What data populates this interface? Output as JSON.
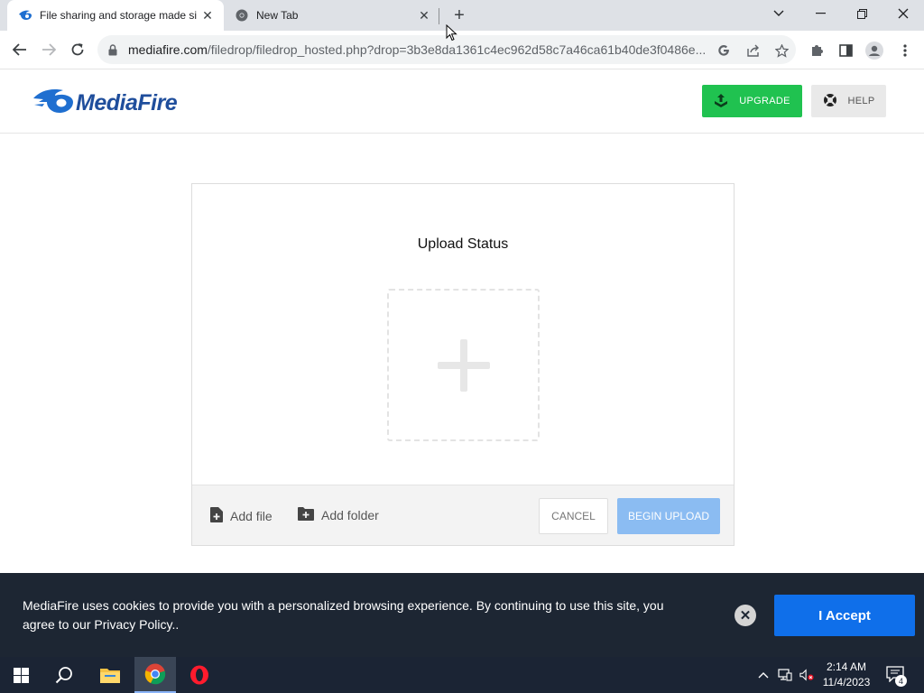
{
  "browser": {
    "tabs": [
      {
        "title": "File sharing and storage made si",
        "active": true
      },
      {
        "title": "New Tab",
        "active": false
      }
    ],
    "url_host": "mediafire.com",
    "url_path": "/filedrop/filedrop_hosted.php?drop=3b3e8da1361c4ec962d58c7a46ca61b40de3f0486e..."
  },
  "header": {
    "logo_text": "MediaFire",
    "upgrade_label": "UPGRADE",
    "help_label": "HELP"
  },
  "upload": {
    "title": "Upload Status",
    "add_file_label": "Add file",
    "add_folder_label": "Add folder",
    "cancel_label": "CANCEL",
    "begin_label": "BEGIN UPLOAD"
  },
  "cookie": {
    "text": "MediaFire uses cookies to provide you with a personalized browsing experience. By continuing to use this site, you agree to our Privacy Policy..",
    "accept_label": "I Accept"
  },
  "taskbar": {
    "time": "2:14 AM",
    "date": "11/4/2023",
    "notification_count": "4"
  },
  "colors": {
    "brand_blue": "#1f4e9c",
    "upgrade_green": "#20c250",
    "accept_blue": "#0f6fea",
    "begin_upload_blue": "#8bbcf2",
    "cookie_bg": "#1d2633"
  }
}
